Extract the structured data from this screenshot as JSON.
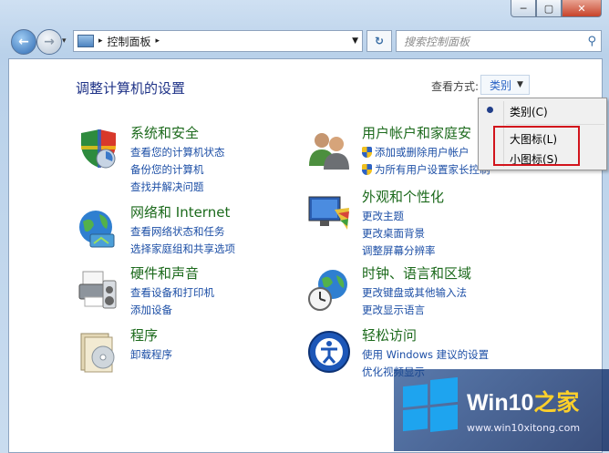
{
  "window": {
    "min": "─",
    "max": "▢",
    "close": "✕"
  },
  "nav": {
    "back": "←",
    "forward": "→",
    "dropdown": "▾",
    "breadcrumb_sep": "▸",
    "address": "控制面板",
    "address_tail": "▸",
    "address_dd": "▼",
    "refresh": "↻",
    "search_placeholder": "搜索控制面板",
    "search_icon": "⚲"
  },
  "page": {
    "title": "调整计算机的设置",
    "view_by_label": "查看方式:",
    "view_by_value": "类别",
    "view_by_arrow": "▼"
  },
  "categories": [
    {
      "icon": "shield-icon",
      "title": "系统和安全",
      "links": [
        "查看您的计算机状态",
        "备份您的计算机",
        "查找并解决问题"
      ]
    },
    {
      "icon": "network-icon",
      "title": "网络和 Internet",
      "links": [
        "查看网络状态和任务",
        "选择家庭组和共享选项"
      ]
    },
    {
      "icon": "printer-icon",
      "title": "硬件和声音",
      "links": [
        "查看设备和打印机",
        "添加设备"
      ]
    },
    {
      "icon": "programs-icon",
      "title": "程序",
      "links": [
        "卸载程序"
      ]
    },
    {
      "icon": "users-icon",
      "title": "用户帐户和家庭安",
      "links": [
        "添加或删除用户帐户",
        "为所有用户设置家长控制"
      ]
    },
    {
      "icon": "appearance-icon",
      "title": "外观和个性化",
      "links": [
        "更改主题",
        "更改桌面背景",
        "调整屏幕分辨率"
      ]
    },
    {
      "icon": "globe-clock-icon",
      "title": "时钟、语言和区域",
      "links": [
        "更改键盘或其他输入法",
        "更改显示语言"
      ]
    },
    {
      "icon": "ease-of-access-icon",
      "title": "轻松访问",
      "links": [
        "使用 Windows 建议的设置",
        "优化视频显示"
      ]
    }
  ],
  "view_menu": {
    "items": [
      "类别(C)",
      "大图标(L)",
      "小图标(S)"
    ],
    "selected": 0
  },
  "watermark": {
    "brand_a": "Win10",
    "brand_b": "之家",
    "url": "www.win10xitong.com"
  },
  "colors": {
    "accent": "#2b64c5",
    "heading": "#1c6a1c",
    "highlight": "#d2141c"
  }
}
